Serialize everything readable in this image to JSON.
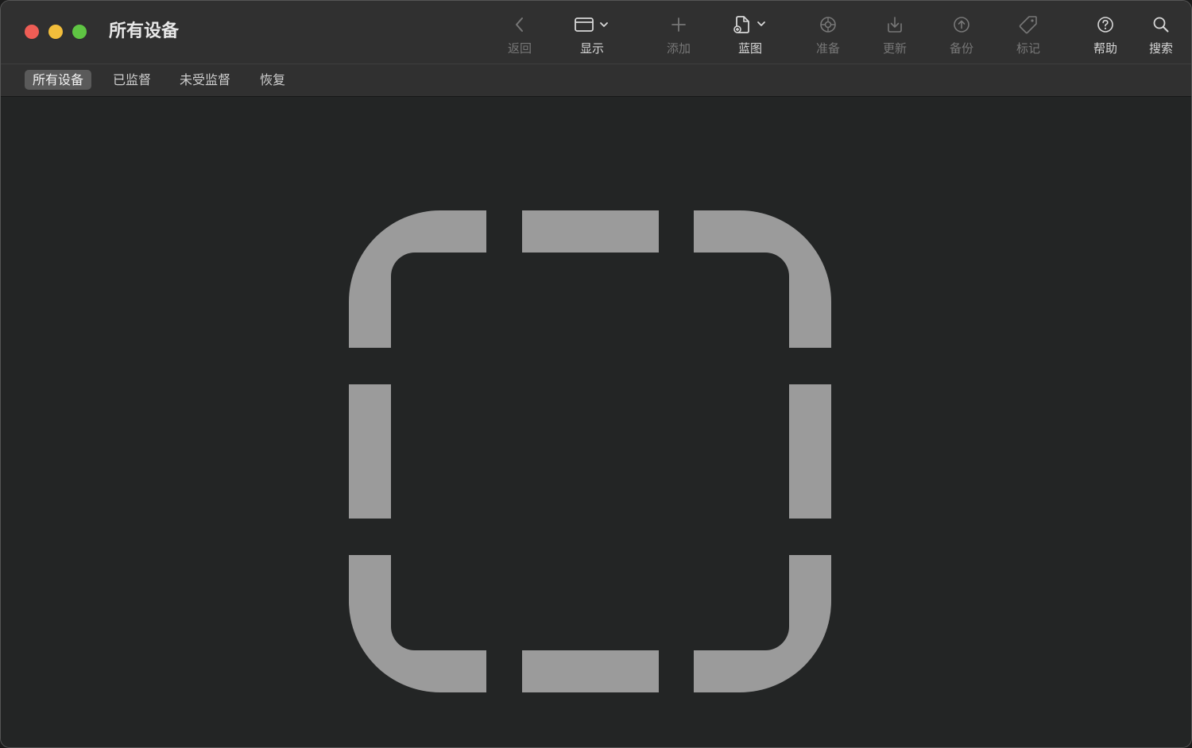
{
  "window": {
    "title": "所有设备"
  },
  "toolbar": {
    "items": [
      {
        "label": "返回",
        "icon": "chevron-left-icon",
        "enabled": false
      },
      {
        "label": "显示",
        "icon": "window-icon",
        "enabled": true
      },
      {
        "label": "添加",
        "icon": "plus-icon",
        "enabled": false
      },
      {
        "label": "蓝图",
        "icon": "blueprint-document-icon",
        "enabled": true
      },
      {
        "label": "准备",
        "icon": "prepare-gear-icon",
        "enabled": false
      },
      {
        "label": "更新",
        "icon": "download-tray-icon",
        "enabled": false
      },
      {
        "label": "备份",
        "icon": "backup-upload-icon",
        "enabled": false
      },
      {
        "label": "标记",
        "icon": "tag-icon",
        "enabled": false
      },
      {
        "label": "帮助",
        "icon": "help-question-icon",
        "enabled": true
      },
      {
        "label": "搜索",
        "icon": "search-icon",
        "enabled": true
      }
    ]
  },
  "tabs": [
    {
      "label": "所有设备",
      "active": true
    },
    {
      "label": "已监督",
      "active": false
    },
    {
      "label": "未受监督",
      "active": false
    },
    {
      "label": "恢复",
      "active": false
    }
  ],
  "content": {
    "placeholder_icon": "dashed-rounded-square-icon"
  },
  "colors": {
    "title_bar": "#303030",
    "content_bg": "#232525",
    "placeholder": "#9b9b9b",
    "close": "#ee5d55",
    "minimize": "#f3be3b",
    "zoom": "#5fc543",
    "active_tab": "#5a5a5a"
  }
}
